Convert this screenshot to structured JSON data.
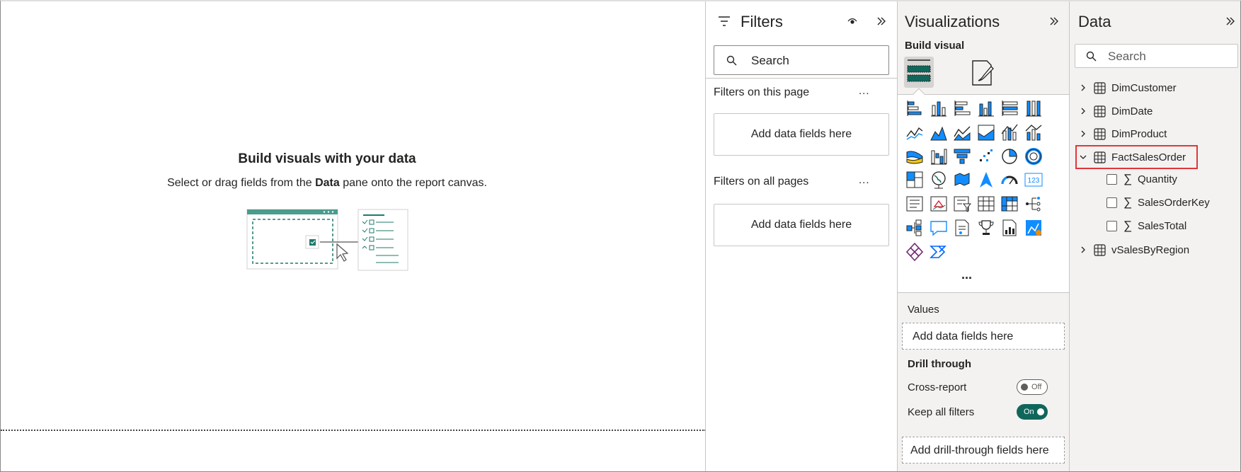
{
  "canvas": {
    "title": "Build visuals with your data",
    "subtitle_before": "Select or drag fields from the ",
    "subtitle_bold": "Data",
    "subtitle_after": " pane onto the report canvas."
  },
  "filters": {
    "title": "Filters",
    "search_placeholder": "Search",
    "this_page_label": "Filters on this page",
    "this_page_drop": "Add data fields here",
    "all_pages_label": "Filters on all pages",
    "all_pages_drop": "Add data fields here",
    "more": "..."
  },
  "visualizations": {
    "title": "Visualizations",
    "build_visual_label": "Build visual",
    "icons": [
      "stacked-bar-chart-icon",
      "stacked-column-chart-icon",
      "clustered-bar-chart-icon",
      "clustered-column-chart-icon",
      "100-stacked-bar-chart-icon",
      "100-stacked-column-chart-icon",
      "line-chart-icon",
      "area-chart-icon",
      "stacked-area-chart-icon",
      "100-stacked-area-chart-icon",
      "line-and-stacked-column-chart-icon",
      "line-and-clustered-column-chart-icon",
      "ribbon-chart-icon",
      "waterfall-chart-icon",
      "funnel-chart-icon",
      "scatter-chart-icon",
      "pie-chart-icon",
      "donut-chart-icon",
      "treemap-icon",
      "map-icon",
      "filled-map-icon",
      "azure-map-icon",
      "gauge-icon",
      "card-icon",
      "multi-row-card-icon",
      "kpi-icon",
      "slicer-icon",
      "table-icon",
      "matrix-icon",
      "decomposition-tree-icon",
      "key-influencers-icon",
      "qa-icon",
      "smart-narrative-icon",
      "metrics-icon",
      "paginated-report-icon",
      "arcgis-map-icon",
      "power-apps-icon",
      "power-automate-icon"
    ],
    "more_label": "...",
    "values_label": "Values",
    "values_drop": "Add data fields here",
    "drill_through_label": "Drill through",
    "cross_report_label": "Cross-report",
    "cross_report_state": "Off",
    "keep_filters_label": "Keep all filters",
    "keep_filters_state": "On",
    "drill_drop": "Add drill-through fields here",
    "card_text": "123"
  },
  "data_pane": {
    "title": "Data",
    "search_placeholder": "Search",
    "tables": [
      {
        "name": "DimCustomer",
        "expanded": false
      },
      {
        "name": "DimDate",
        "expanded": false
      },
      {
        "name": "DimProduct",
        "expanded": false
      },
      {
        "name": "FactSalesOrder",
        "expanded": true
      },
      {
        "name": "vSalesByRegion",
        "expanded": false
      }
    ],
    "fields": [
      "Quantity",
      "SalesOrderKey",
      "SalesTotal"
    ],
    "sigma": "∑",
    "highlight_color": "#e0363a"
  },
  "colors": {
    "accent_teal": "#11665b",
    "viz_blue": "#118dff",
    "pane_bg": "#f3f2f1"
  }
}
